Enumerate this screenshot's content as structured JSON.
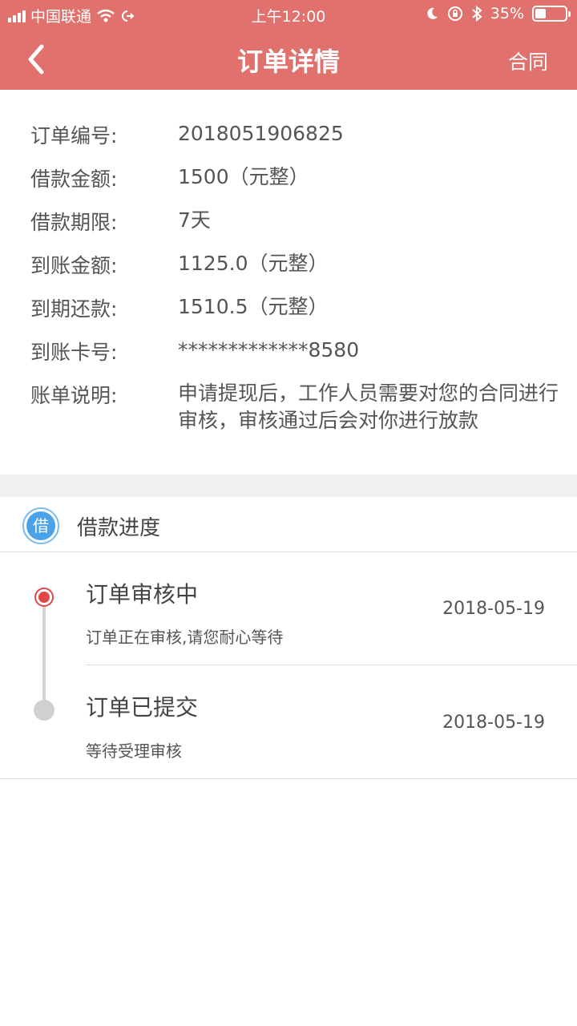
{
  "status_bar": {
    "carrier": "中国联通",
    "time": "上午12:00",
    "battery": "35%",
    "battery_level": 0.35
  },
  "nav": {
    "title": "订单详情",
    "contract_label": "合同"
  },
  "details": [
    {
      "label": "订单编号:",
      "value": "2018051906825"
    },
    {
      "label": "借款金额:",
      "value": "1500（元整）"
    },
    {
      "label": "借款期限:",
      "value": "7天"
    },
    {
      "label": "到账金额:",
      "value": "1125.0（元整）"
    },
    {
      "label": "到期还款:",
      "value": "1510.5（元整）"
    },
    {
      "label": "到账卡号:",
      "value": "*************8580"
    },
    {
      "label": "账单说明:",
      "value": "申请提现后，工作人员需要对您的合同进行审核，审核通过后会对你进行放款"
    }
  ],
  "progress": {
    "badge": "借",
    "title": "借款进度",
    "steps": [
      {
        "title": "订单审核中",
        "desc": "订单正在审核,请您耐心等待",
        "date": "2018-05-19"
      },
      {
        "title": "订单已提交",
        "desc": "等待受理审核",
        "date": "2018-05-19"
      }
    ]
  },
  "colors": {
    "header": "#e0716c",
    "active_dot": "#e04848",
    "badge": "#4aa3e8"
  }
}
